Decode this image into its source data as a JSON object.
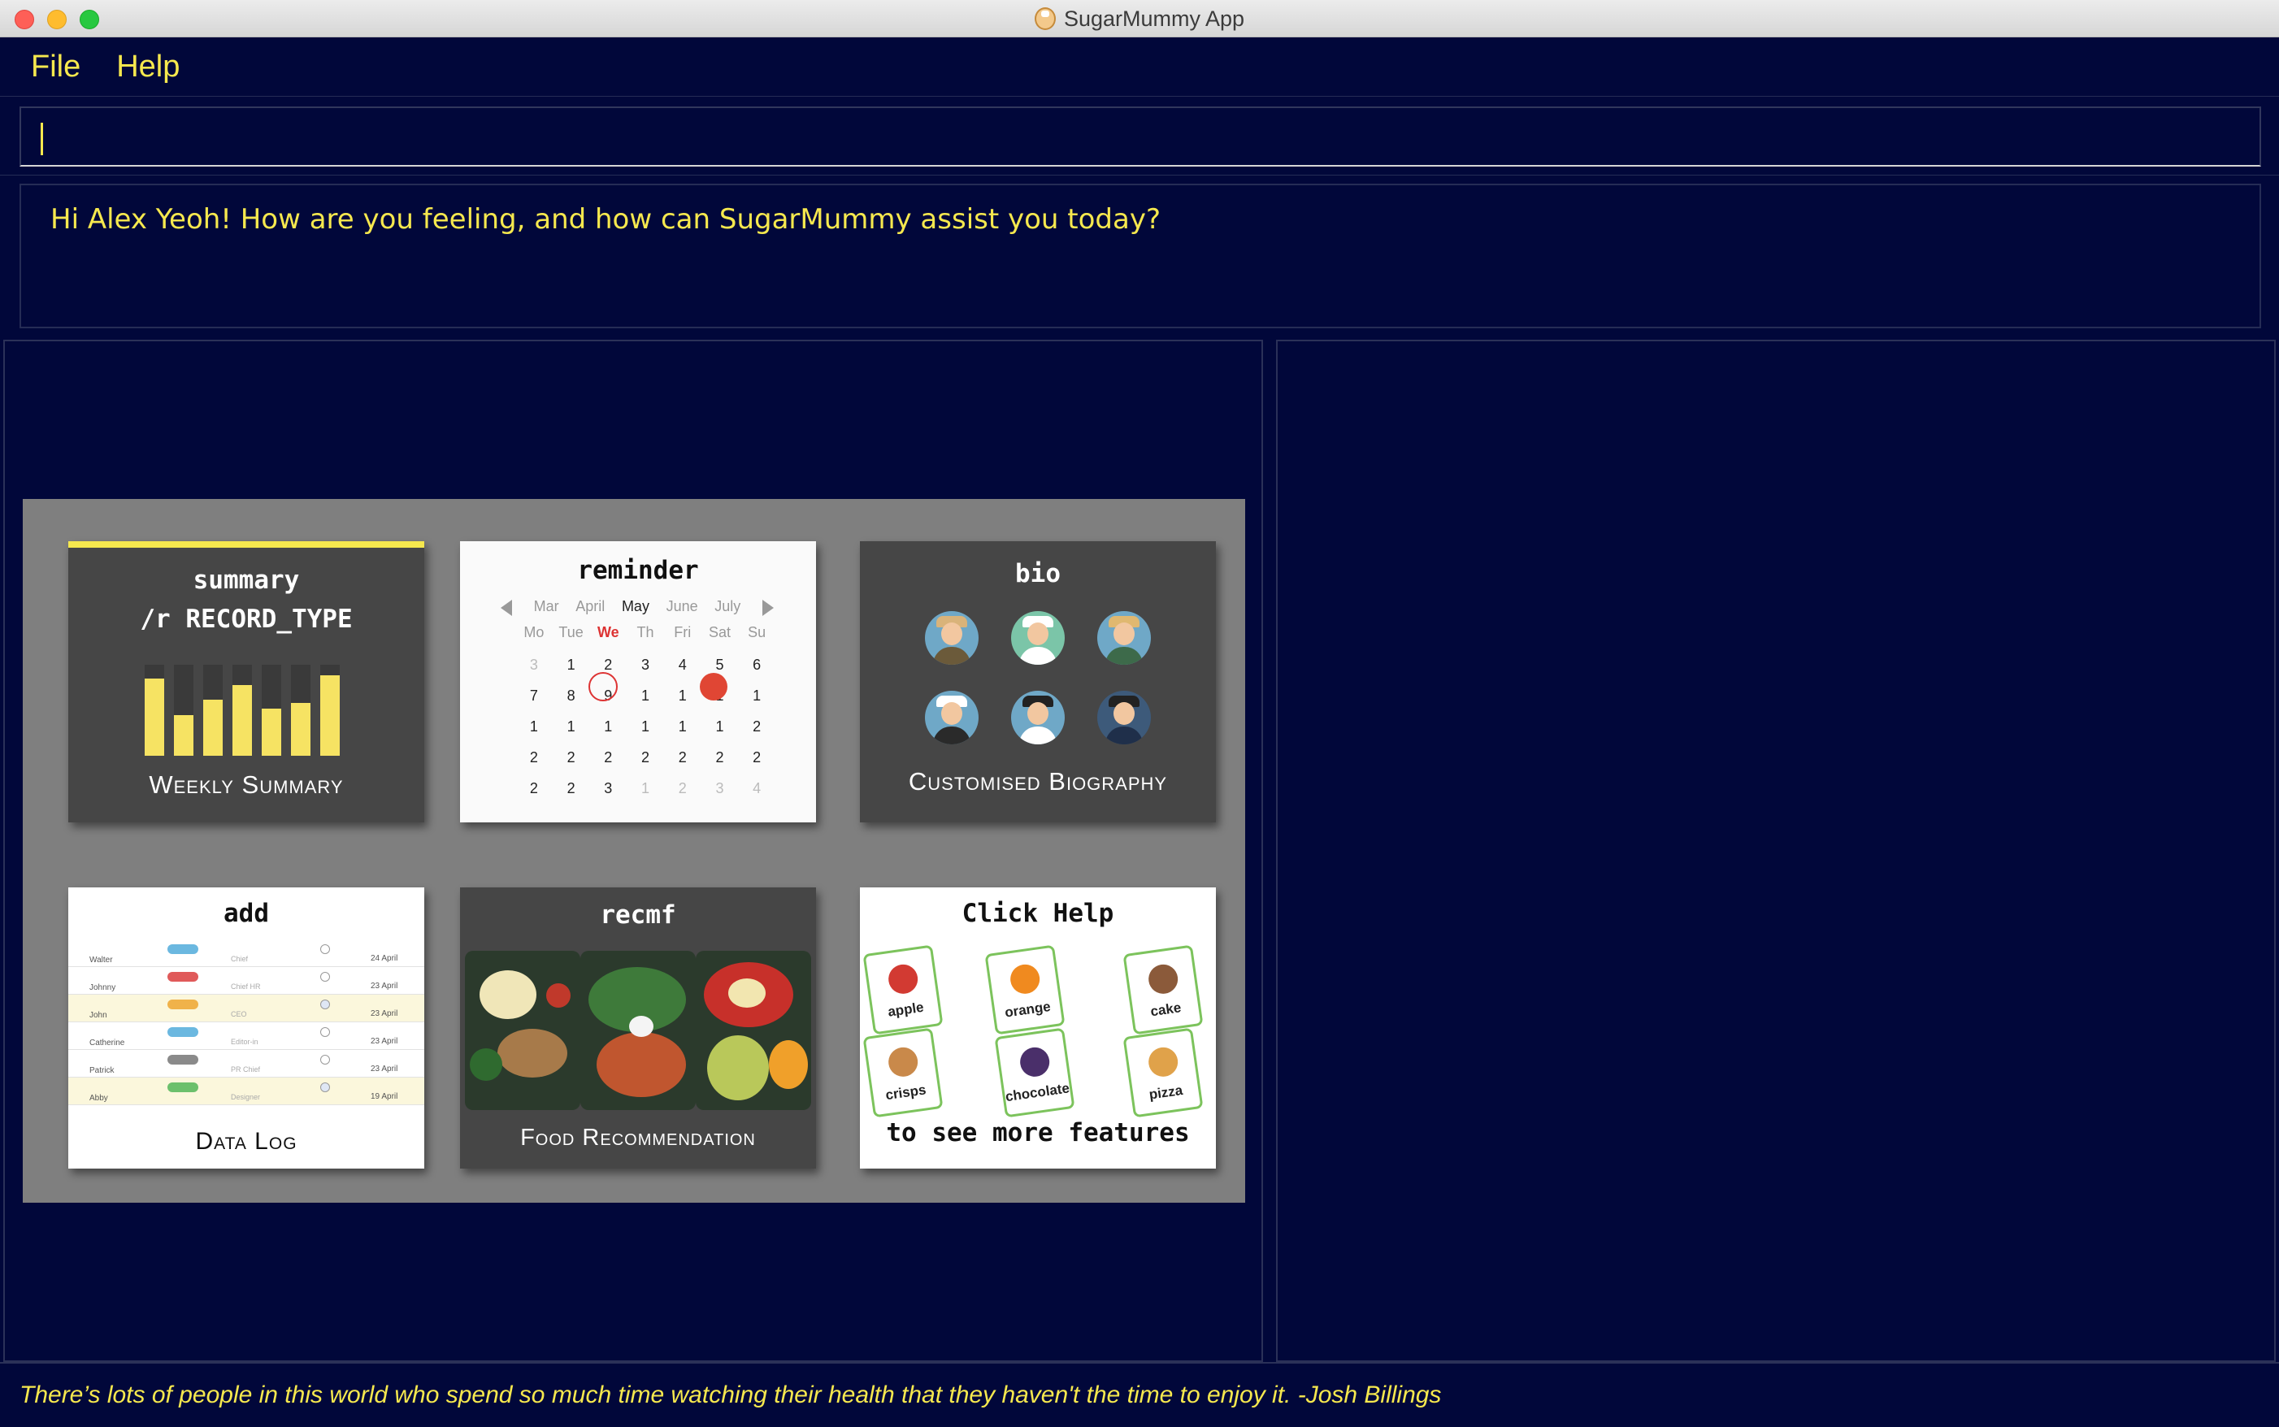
{
  "window": {
    "title": "SugarMummy App"
  },
  "menu": {
    "file": "File",
    "help": "Help"
  },
  "command": {
    "value": ""
  },
  "result": {
    "text": "Hi Alex Yeoh! How are you feeling, and how can SugarMummy assist you today?"
  },
  "features": {
    "summary": {
      "line1": "summary",
      "line2": "/r RECORD_TYPE",
      "caption": "Weekly Summary",
      "bars": [
        0.85,
        0.45,
        0.62,
        0.78,
        0.52,
        0.58,
        0.88
      ]
    },
    "reminder": {
      "title": "reminder",
      "months": [
        "Mar",
        "April",
        "May",
        "June",
        "July"
      ],
      "days": [
        "Mo",
        "Tue",
        "We",
        "Th",
        "Fri",
        "Sat",
        "Su"
      ],
      "rows": [
        [
          "3",
          "1",
          "2",
          "3",
          "4",
          "5",
          "6"
        ],
        [
          "7",
          "8",
          "9",
          "1",
          "1",
          "1",
          "1"
        ],
        [
          "1",
          "1",
          "1",
          "1",
          "1",
          "1",
          "2"
        ],
        [
          "2",
          "2",
          "2",
          "2",
          "2",
          "2",
          "2"
        ],
        [
          "2",
          "2",
          "3",
          "1",
          "2",
          "3",
          "4"
        ]
      ]
    },
    "bio": {
      "title": "bio",
      "caption": "Customised Biography"
    },
    "add": {
      "title": "add",
      "caption": "Data Log",
      "rows": [
        {
          "name": "Walter",
          "role": "Chief",
          "date": "24 April",
          "color": "#6bb8e0",
          "checked": false
        },
        {
          "name": "Johnny",
          "role": "Chief HR",
          "date": "23 April",
          "color": "#e05a5a",
          "checked": false
        },
        {
          "name": "John",
          "role": "CEO",
          "date": "23 April",
          "color": "#f0b24a",
          "checked": true
        },
        {
          "name": "Catherine",
          "role": "Editor-in",
          "date": "23 April",
          "color": "#6bb8e0",
          "checked": false
        },
        {
          "name": "Patrick",
          "role": "PR Chief",
          "date": "23 April",
          "color": "#8a8a8a",
          "checked": false
        },
        {
          "name": "Abby",
          "role": "Designer",
          "date": "19 April",
          "color": "#6cc06c",
          "checked": true
        }
      ]
    },
    "recmf": {
      "title": "recmf",
      "caption": "Food Recommendation"
    },
    "help": {
      "title": "Click Help",
      "subtitle": "to see more features",
      "cards": [
        {
          "label": "apple",
          "icon": "apple-icon",
          "color": "#d23a32"
        },
        {
          "label": "orange",
          "icon": "orange-icon",
          "color": "#f08a1f"
        },
        {
          "label": "cake",
          "icon": "cake-icon",
          "color": "#8b5a3a"
        },
        {
          "label": "crisps",
          "icon": "crisps-icon",
          "color": "#c9894a"
        },
        {
          "label": "chocolate",
          "icon": "chocolate-icon",
          "color": "#4a2f6a"
        },
        {
          "label": "pizza",
          "icon": "pizza-icon",
          "color": "#e0a24a"
        }
      ]
    }
  },
  "status": {
    "quote": "There’s lots of people in this world who spend so much time watching their health that they haven't the time to enjoy it. -Josh Billings"
  },
  "colors": {
    "background": "#01073a",
    "accent": "#f6e84e",
    "grid": "#7f7f7f",
    "card_dark": "#464646"
  }
}
